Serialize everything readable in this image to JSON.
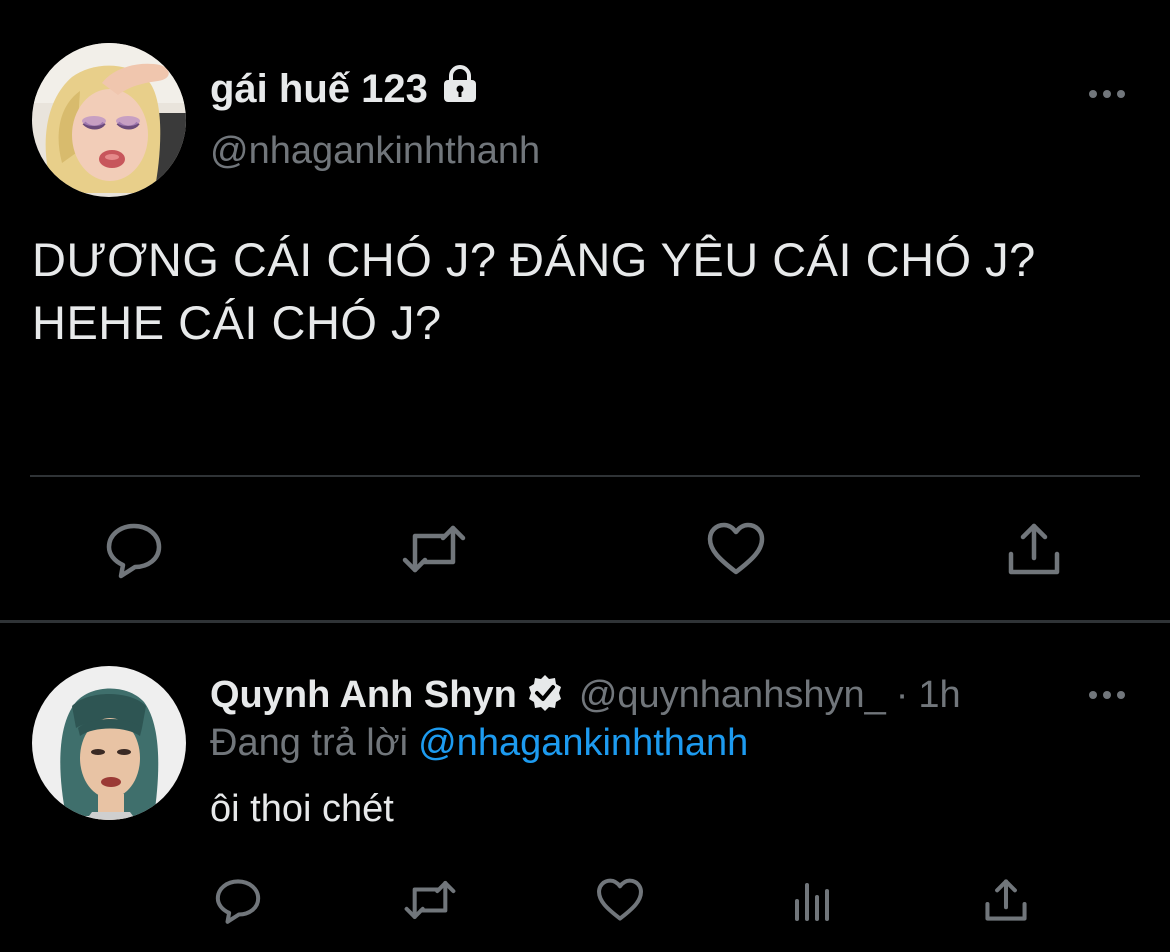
{
  "colors": {
    "background": "#000000",
    "text_primary": "#e7e9ea",
    "text_secondary": "#71767b",
    "link": "#1d9bf0",
    "divider": "#2f3336"
  },
  "main_tweet": {
    "display_name": "gái huế 123",
    "handle": "@nhagankinhthanh",
    "protected_icon": "lock-icon",
    "text_line1": "DƯƠNG CÁI CHÓ J? ĐÁNG YÊU CÁI CHÓ J?",
    "text_line2": "HEHE CÁI CHÓ J?",
    "actions": [
      "reply-icon",
      "retweet-icon",
      "heart-icon",
      "share-icon"
    ]
  },
  "reply_tweet": {
    "display_name": "Quynh Anh Shyn",
    "verified_icon": "verified-badge-icon",
    "handle": "@quynhanhshyn_",
    "separator": "·",
    "time": "1h",
    "replying_label": "Đang trả lời",
    "replying_mention": "@nhagankinhthanh",
    "text": "ôi thoi chét",
    "actions": [
      "reply-icon",
      "retweet-icon",
      "heart-icon",
      "views-icon",
      "share-icon"
    ]
  }
}
